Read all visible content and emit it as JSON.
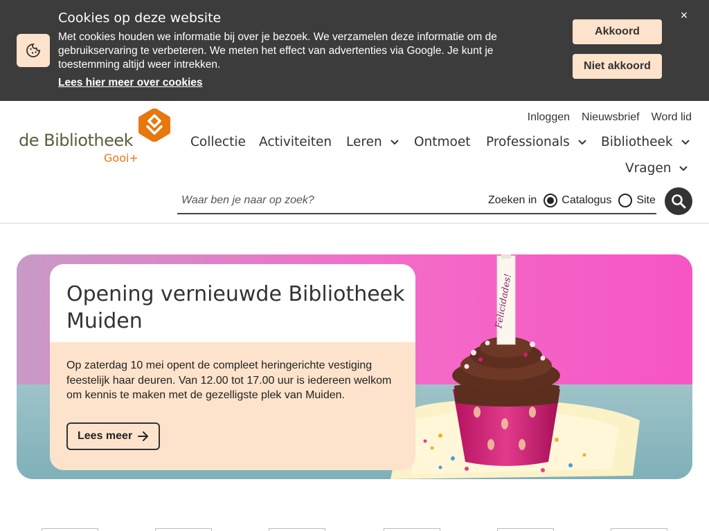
{
  "cookie_banner": {
    "title": "Cookies op deze website",
    "text": "Met cookies houden we informatie bij over je bezoek. We verzamelen deze informatie om de gebruikservaring te verbeteren. We meten het effect van advertenties via Google. Je kunt je toestemming altijd weer intrekken.",
    "link": "Lees hier meer over cookies",
    "accept_label": "Akkoord",
    "decline_label": "Niet akkoord",
    "close_label": "×"
  },
  "logo": {
    "text": "de Bibliotheek",
    "sub": "Gooi+"
  },
  "top_links": [
    "Inloggen",
    "Nieuwsbrief",
    "Word lid"
  ],
  "nav": [
    {
      "label": "Collectie",
      "has_dropdown": false
    },
    {
      "label": "Activiteiten",
      "has_dropdown": false
    },
    {
      "label": "Leren",
      "has_dropdown": true
    },
    {
      "label": "Ontmoet",
      "has_dropdown": false
    },
    {
      "label": "Professionals",
      "has_dropdown": true
    },
    {
      "label": "Bibliotheek",
      "has_dropdown": true
    },
    {
      "label": "Vragen",
      "has_dropdown": true
    }
  ],
  "search": {
    "placeholder": "Waar ben je naar op zoek?",
    "scope_label": "Zoeken in",
    "options": [
      {
        "label": "Catalogus",
        "selected": true
      },
      {
        "label": "Site",
        "selected": false
      }
    ]
  },
  "hero": {
    "title": "Opening vernieuwde Bibliotheek Muiden",
    "text": "Op zaterdag 10 mei opent de compleet heringerichte vestiging feestelijk haar deuren. Van 12.00 tot 17.00 uur is iedereen welkom om kennis te maken met de gezelligste plek van Muiden.",
    "button_label": "Lees meer",
    "candle_text": "Felicidades!"
  },
  "colors": {
    "banner_bg": "#3c3c3c",
    "accent_peach": "#fde3cc",
    "brand_orange": "#e8770e",
    "logo_olive": "#5d5d3c"
  }
}
